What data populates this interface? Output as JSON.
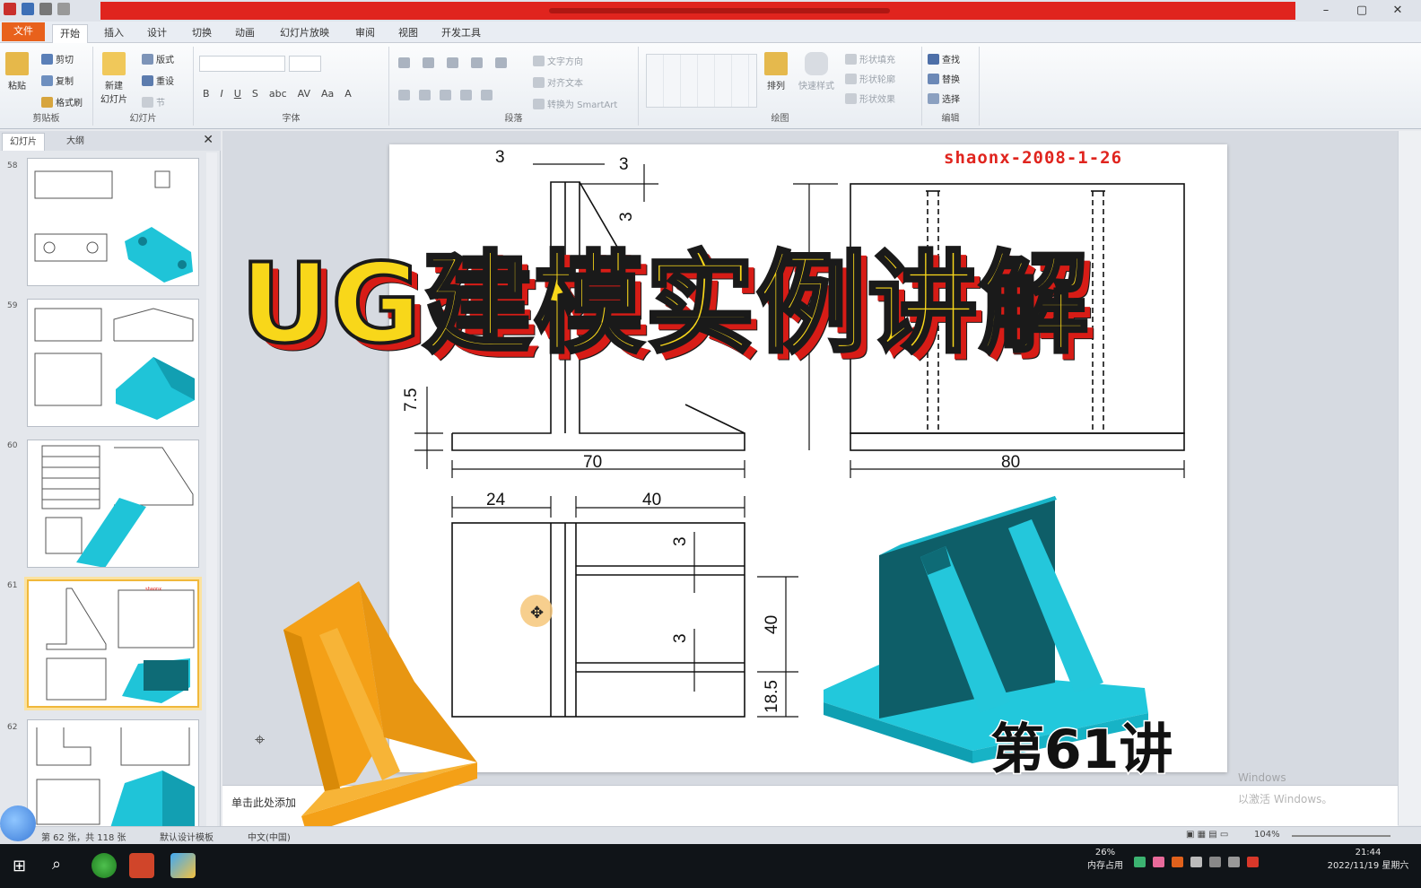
{
  "window": {
    "minimize": "–",
    "restore": "▢",
    "close": "✕"
  },
  "ribbon_tabs": [
    "文件",
    "开始",
    "插入",
    "设计",
    "切换",
    "动画",
    "幻灯片放映",
    "审阅",
    "视图",
    "开发工具"
  ],
  "ribbon": {
    "clipboard": {
      "paste": "粘贴",
      "cut": "剪切",
      "copy": "复制",
      "format_painter": "格式刷",
      "label": "剪贴板"
    },
    "slides": {
      "new_slide": "新建\n幻灯片",
      "layout": "版式",
      "reset": "重设",
      "section": "节",
      "label": "幻灯片"
    },
    "font": {
      "label": "字体"
    },
    "paragraph": {
      "text_direction": "文字方向",
      "align_text": "对齐文本",
      "smartart": "转换为 SmartArt",
      "label": "段落"
    },
    "drawing": {
      "arrange": "排列",
      "quick_styles": "快速样式",
      "shape_fill": "形状填充",
      "shape_outline": "形状轮廓",
      "shape_effects": "形状效果",
      "label": "绘图"
    },
    "editing": {
      "find": "查找",
      "replace": "替换",
      "select": "选择",
      "label": "编辑"
    }
  },
  "left_pane": {
    "tab_slides": "幻灯片",
    "tab_outline": "大纲",
    "close": "✕",
    "slide_numbers": [
      "58",
      "59",
      "60",
      "61",
      "62"
    ]
  },
  "slide": {
    "watermark": "shaonx-2008-1-26",
    "dims": {
      "d3a": "3",
      "d3b": "3",
      "d3c": "3",
      "d7_5": "7.5",
      "d70": "70",
      "d80": "80",
      "d24": "24",
      "d40a": "40",
      "d3d": "3",
      "d3e": "3",
      "d40b": "40",
      "d18_5": "18.5"
    }
  },
  "overlay": {
    "title": "UG建模实例讲解",
    "episode": "第61讲"
  },
  "notes_placeholder": "单击此处添加",
  "status": {
    "slide_info": "第 62 张，共 118 张",
    "theme": "默认设计模板",
    "language": "中文(中国)",
    "zoom": "104%"
  },
  "taskbar": {
    "cpu": "26%",
    "cpu_label": "内存占用",
    "time": "21:44",
    "date": "2022/11/19 星期六"
  },
  "windows_watermark": {
    "line1": "Windows",
    "line2": "以激活 Windows。"
  },
  "colors": {
    "accent_red": "#e0241e",
    "title_yellow": "#f8d71a",
    "model_cyan": "#1fc4d8",
    "model_orange": "#f4a017"
  }
}
